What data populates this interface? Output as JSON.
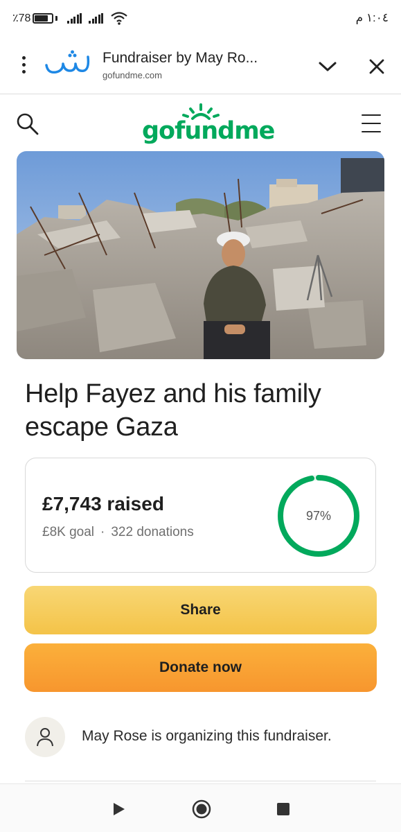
{
  "status_bar": {
    "battery_percent": "٪78",
    "time": "١:٠٤ م"
  },
  "browser": {
    "app_logo_text": "بشر",
    "title": "Fundraiser by May Ro...",
    "url": "gofundme.com"
  },
  "site": {
    "logo": "gofundme",
    "brand_color": "#02a95c"
  },
  "campaign": {
    "title": "Help Fayez and his family escape Gaza",
    "raised": "£7,743 raised",
    "goal": "£8K goal",
    "separator": "·",
    "donations": "322 donations",
    "progress_label": "97%",
    "progress_fraction": 0.97
  },
  "actions": {
    "share_label": "Share",
    "donate_label": "Donate now"
  },
  "organizer": {
    "text": "May Rose is organizing this fundraiser."
  },
  "icons": {
    "menu": "kebab-menu-icon",
    "chevron": "chevron-down-icon",
    "close": "close-icon",
    "search": "search-icon",
    "hamburger": "hamburger-menu-icon",
    "user": "user-icon"
  }
}
